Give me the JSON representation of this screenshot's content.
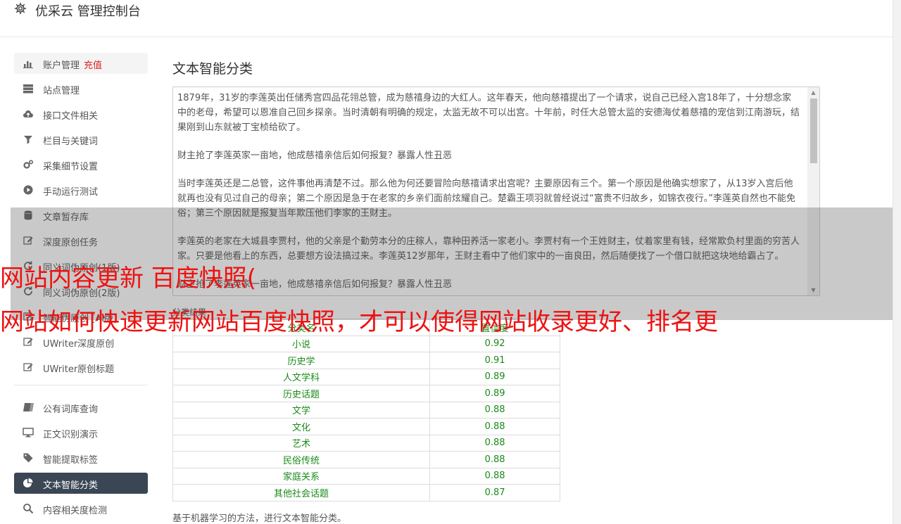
{
  "app": {
    "title": "优采云 管理控制台",
    "icon": "gear-icon"
  },
  "sidebar": {
    "group1": [
      {
        "name": "account",
        "icon": "bar-chart-icon",
        "label": "账户管理",
        "extra": "充值"
      },
      {
        "name": "site",
        "icon": "server-icon",
        "label": "站点管理"
      },
      {
        "name": "api-files",
        "icon": "cloud-upload-icon",
        "label": "接口文件相关"
      },
      {
        "name": "columns-keywords",
        "icon": "filter-icon",
        "label": "栏目与关键词"
      },
      {
        "name": "collect-settings",
        "icon": "cogs-icon",
        "label": "采集细节设置"
      },
      {
        "name": "manual-run",
        "icon": "play-circle-icon",
        "label": "手动运行测试"
      },
      {
        "name": "article-store",
        "icon": "database-icon",
        "label": "文章暂存库"
      },
      {
        "name": "deep-original",
        "icon": "edit-icon",
        "label": "深度原创任务"
      },
      {
        "name": "synonym-1",
        "icon": "refresh-icon",
        "label": "同义词伪原创(1版)"
      },
      {
        "name": "synonym-2",
        "icon": "refresh-icon",
        "label": "同义词伪原创(2版)"
      },
      {
        "name": "ai-pseudo",
        "icon": "edit-icon",
        "label": "智能伪原创 [AI版]"
      },
      {
        "name": "uwriter-deep",
        "icon": "edit-icon",
        "label": "UWriter深度原创"
      },
      {
        "name": "uwriter-title",
        "icon": "edit-icon",
        "label": "UWriter原创标题"
      }
    ],
    "group2": [
      {
        "name": "public-lexicon",
        "icon": "book-icon",
        "label": "公有词库查询"
      },
      {
        "name": "text-recognition",
        "icon": "monitor-icon",
        "label": "正文识别演示"
      },
      {
        "name": "tag-extract",
        "icon": "tag-icon",
        "label": "智能提取标签"
      },
      {
        "name": "text-classify",
        "icon": "pie-chart-icon",
        "label": "文本智能分类"
      },
      {
        "name": "relevance",
        "icon": "search-icon",
        "label": "内容相关度检测"
      }
    ]
  },
  "main": {
    "title": "文本智能分类",
    "text_paragraphs": [
      "1879年，31岁的李莲英出任储秀宫四品花翎总管，成为慈禧身边的大红人。这年春天，他向慈禧提出了一个请求，说自己已经入宫18年了，十分想念家中的老母，希望可以恩准自己回乡探亲。当时清朝有明确的规定，太监无故不可以出宫。十年前，时任大总管太监的安德海仗着慈禧的宠信到江南游玩，结果刚到山东就被丁宝桢给砍了。",
      "财主抢了李莲英家一亩地，他成慈禧亲信后如何报复？暴露人性丑恶",
      "当时李莲英还是二总管，这件事他再清楚不过。那么他为何还要冒险向慈禧请求出宫呢？主要原因有三个。第一个原因是他确实想家了，从13岁入宫后他就再也没有见过自己的母亲；第二个原因是急于在老家的乡亲们面前炫耀自己。楚霸王项羽就曾经说过“富贵不归故乡，如锦衣夜行。”李莲英自然也不能免俗；第三个原因就是报复当年欺压他们李家的王财主。",
      "李莲英的老家在大城县李贾村，他的父亲是个勤劳本分的庄稼人，靠种田养活一家老小。李贾村有一个王姓财主，仗着家里有钱，经常欺负村里面的穷苦人家。只要是他看上的东西，总要想方设法搞过来。李莲英12岁那年，王财主看中了他们家中的一亩良田，然后随便找了一个借口就把这块地给霸占了。",
      "财主抢了李莲英家一亩地，他成慈禧亲信后如何报复？暴露人性丑恶"
    ],
    "result_label": "分类结果",
    "table_headers": [
      "分类名",
      "置信度"
    ],
    "table_rows": [
      [
        "小说",
        "0.92"
      ],
      [
        "历史学",
        "0.91"
      ],
      [
        "人文学科",
        "0.89"
      ],
      [
        "历史话题",
        "0.89"
      ],
      [
        "文学",
        "0.88"
      ],
      [
        "文化",
        "0.88"
      ],
      [
        "艺术",
        "0.88"
      ],
      [
        "民俗传统",
        "0.88"
      ],
      [
        "家庭关系",
        "0.88"
      ],
      [
        "其他社会话题",
        "0.87"
      ]
    ],
    "note": "基于机器学习的方法，进行文本智能分类。"
  },
  "overlay_ad": {
    "line1": "网站内容更新 百度快照(",
    "line2": "网站如何快速更新网站百度快照，才可以使得网站收录更好、排名更"
  },
  "colors": {
    "active_bg": "#3a4654",
    "accent_red": "#e02020",
    "result_green": "#1a8a1a",
    "ad_red": "#ee1111"
  }
}
